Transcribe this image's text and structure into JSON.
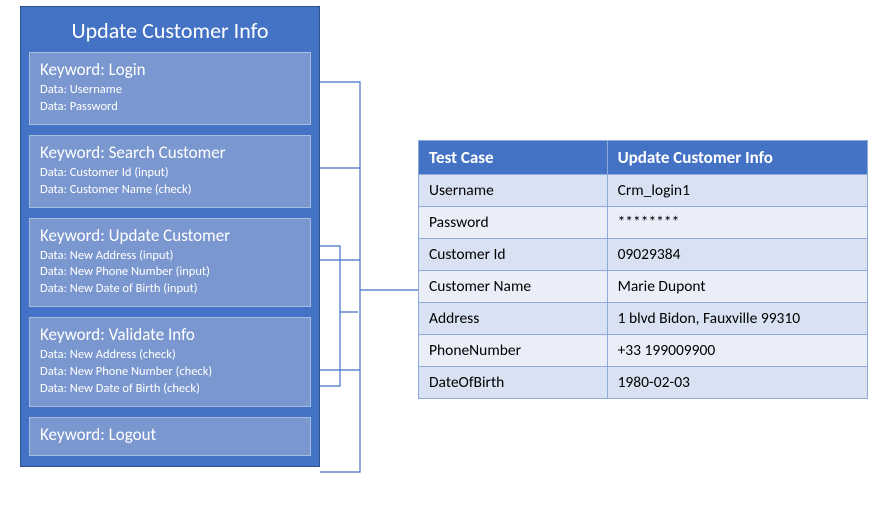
{
  "panel": {
    "title": "Update Customer Info",
    "boxes": [
      {
        "title": "Keyword: Login",
        "lines": [
          "Data: Username",
          "Data: Password"
        ]
      },
      {
        "title": "Keyword: Search Customer",
        "lines": [
          "Data: Customer Id (input)",
          "Data: Customer Name (check)"
        ]
      },
      {
        "title": "Keyword: Update Customer",
        "lines": [
          "Data: New Address (input)",
          "Data: New Phone Number (input)",
          "Data: New Date of Birth (input)"
        ]
      },
      {
        "title": "Keyword: Validate Info",
        "lines": [
          "Data: New Address (check)",
          "Data: New Phone Number (check)",
          "Data: New Date of Birth (check)"
        ]
      },
      {
        "title": "Keyword: Logout",
        "lines": []
      }
    ]
  },
  "table": {
    "header": {
      "col1": "Test Case",
      "col2": "Update Customer Info"
    },
    "rows": [
      {
        "k": "Username",
        "v": "Crm_login1"
      },
      {
        "k": "Password",
        "v": "********"
      },
      {
        "k": "Customer Id",
        "v": "09029384"
      },
      {
        "k": "Customer Name",
        "v": "Marie Dupont"
      },
      {
        "k": "Address",
        "v": "1 blvd Bidon, Fauxville 99310"
      },
      {
        "k": "PhoneNumber",
        "v": "+33 199009900"
      },
      {
        "k": "DateOfBirth",
        "v": "1980-02-03"
      }
    ]
  }
}
